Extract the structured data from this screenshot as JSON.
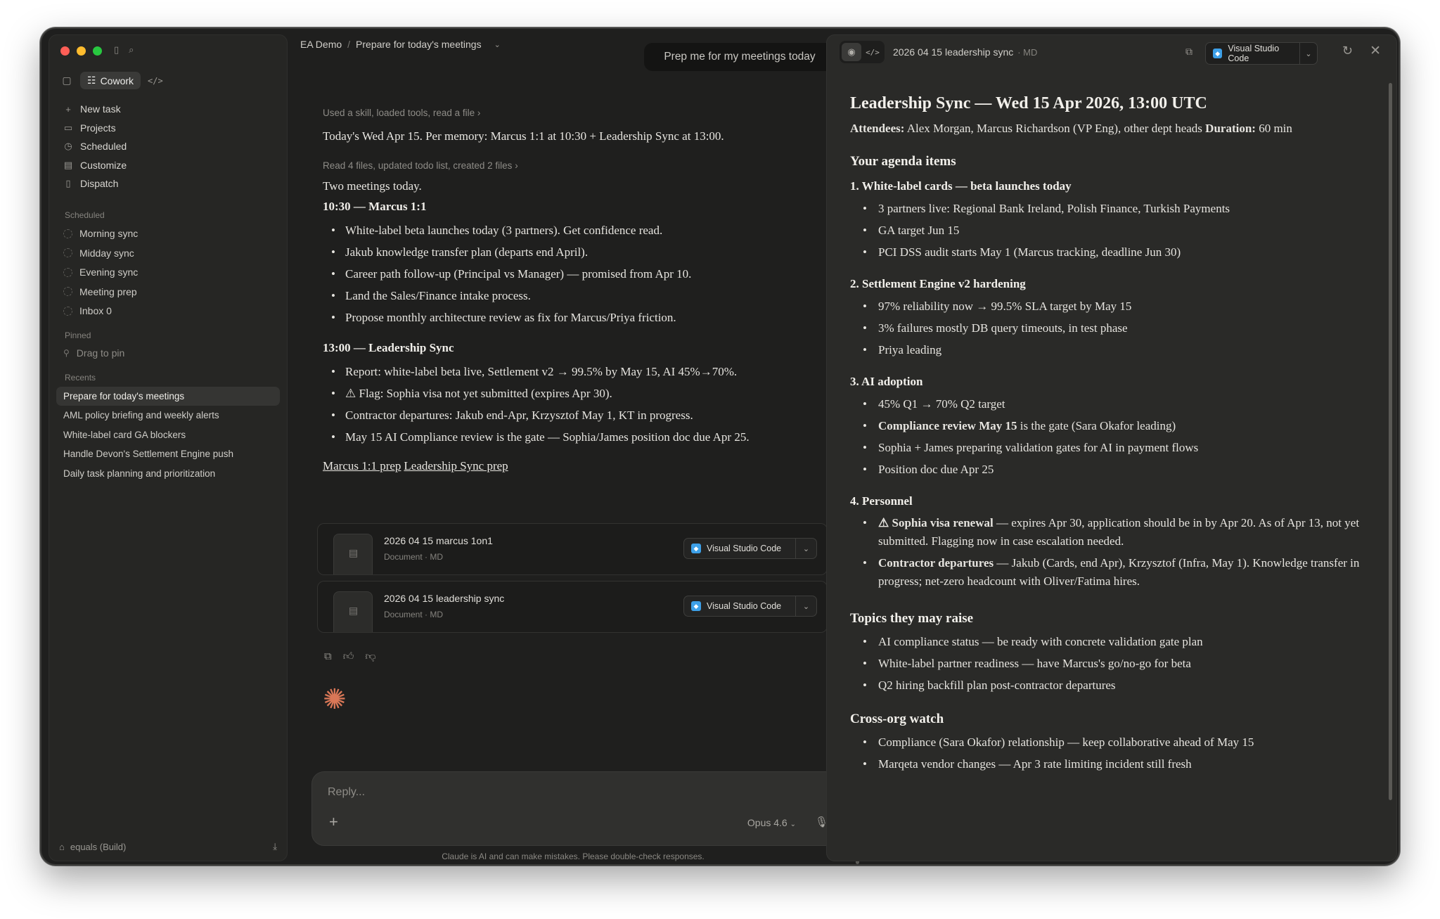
{
  "sidebar": {
    "mode_label": "Cowork",
    "nav": [
      {
        "icon": "plus-icon",
        "label": "New task"
      },
      {
        "icon": "folder-icon",
        "label": "Projects"
      },
      {
        "icon": "clock-icon",
        "label": "Scheduled"
      },
      {
        "icon": "customize-icon",
        "label": "Customize"
      },
      {
        "icon": "phone-icon",
        "label": "Dispatch"
      }
    ],
    "scheduled_label": "Scheduled",
    "scheduled": [
      "Morning sync",
      "Midday sync",
      "Evening sync",
      "Meeting prep",
      "Inbox 0"
    ],
    "pinned_label": "Pinned",
    "pinned_hint": "Drag to pin",
    "recents_label": "Recents",
    "recents": [
      "Prepare for today's meetings",
      "AML policy briefing and weekly alerts",
      "White-label card GA blockers",
      "Handle Devon's Settlement Engine push",
      "Daily task planning and prioritization"
    ],
    "footer_label": "equals (Build)"
  },
  "chat": {
    "breadcrumb_root": "EA Demo",
    "breadcrumb_sep": "/",
    "breadcrumb_current": "Prepare for today's meetings",
    "user_message": "Prep me for my meetings today",
    "tool_line_1": "Used a skill, loaded tools, read a file",
    "intro": "Today's Wed Apr 15. Per memory: Marcus 1:1 at 10:30 + Leadership Sync at 13:00.",
    "tool_line_2": "Read 4 files, updated todo list, created 2 files",
    "summary": "Two meetings today.",
    "meeting1_title": "10:30 — Marcus 1:1",
    "meeting1_bullets": [
      "White-label beta launches today (3 partners). Get confidence read.",
      "Jakub knowledge transfer plan (departs end April).",
      "Career path follow-up (Principal vs Manager) — promised from Apr 10.",
      "Land the Sales/Finance intake process.",
      "Propose monthly architecture review as fix for Marcus/Priya friction."
    ],
    "meeting2_title": "13:00 — Leadership Sync",
    "meeting2_bullets": [
      "Report: white-label beta live, Settlement v2 → 99.5% by May 15, AI 45%→70%.",
      "⚠ Flag: Sophia visa not yet submitted (expires Apr 30).",
      "Contractor departures: Jakub end-Apr, Krzysztof May 1, KT in progress.",
      "May 15 AI Compliance review is the gate — Sophia/James position doc due Apr 25."
    ],
    "link_1": "Marcus 1:1 prep",
    "link_2": "Leadership Sync prep",
    "files": [
      {
        "name": "2026 04 15 marcus 1on1",
        "meta": "Document · MD",
        "open_label": "Visual Studio Code"
      },
      {
        "name": "2026 04 15 leadership sync",
        "meta": "Document · MD",
        "open_label": "Visual Studio Code"
      }
    ],
    "composer_placeholder": "Reply...",
    "model_label": "Opus 4.6",
    "disclaimer": "Claude is AI and can make mistakes. Please double-check responses."
  },
  "doc": {
    "title": "2026 04 15 leadership sync",
    "type": "· MD",
    "open_label": "Visual Studio Code",
    "h1": "Leadership Sync — Wed 15 Apr 2026, 13:00 UTC",
    "attendees_label": "Attendees:",
    "attendees_value": "Alex Morgan, Marcus Richardson (VP Eng), other dept heads",
    "duration_label": "Duration:",
    "duration_value": "60 min",
    "agenda_title": "Your agenda items",
    "sec1_title": "1. White-label cards — beta launches today",
    "sec1_bullets": [
      "3 partners live: Regional Bank Ireland, Polish Finance, Turkish Payments",
      "GA target Jun 15",
      "PCI DSS audit starts May 1 (Marcus tracking, deadline Jun 30)"
    ],
    "sec2_title": "2. Settlement Engine v2 hardening",
    "sec2_bullets": [
      "97% reliability now → 99.5% SLA target by May 15",
      "3% failures mostly DB query timeouts, in test phase",
      "Priya leading"
    ],
    "sec3_title": "3. AI adoption",
    "sec3_b1": "45% Q1 → 70% Q2 target",
    "sec3_b2_bold": "Compliance review May 15",
    "sec3_b2_rest": " is the gate (Sara Okafor leading)",
    "sec3_b3": "Sophia + James preparing validation gates for AI in payment flows",
    "sec3_b4": "Position doc due Apr 25",
    "sec4_title": "4. Personnel",
    "sec4_b1_bold": "⚠ Sophia visa renewal",
    "sec4_b1_rest": " — expires Apr 30, application should be in by Apr 20. As of Apr 13, not yet submitted. Flagging now in case escalation needed.",
    "sec4_b2_bold": "Contractor departures",
    "sec4_b2_rest": " — Jakub (Cards, end Apr), Krzysztof (Infra, May 1). Knowledge transfer in progress; net-zero headcount with Oliver/Fatima hires.",
    "topics_title": "Topics they may raise",
    "topics": [
      "AI compliance status — be ready with concrete validation gate plan",
      "White-label partner readiness — have Marcus's go/no-go for beta",
      "Q2 hiring backfill plan post-contractor departures"
    ],
    "crossorg_title": "Cross-org watch",
    "crossorg": [
      "Compliance (Sara Okafor) relationship — keep collaborative ahead of May 15",
      "Marqeta vendor changes — Apr 3 rate limiting incident still fresh"
    ]
  }
}
